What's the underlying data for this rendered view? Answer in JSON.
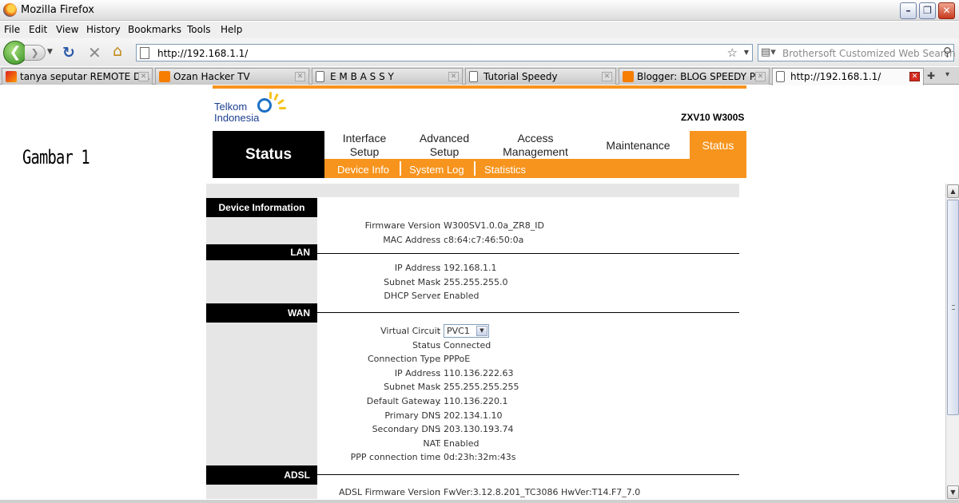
{
  "window": {
    "title": "Mozilla Firefox"
  },
  "menubar": [
    "File",
    "Edit",
    "View",
    "History",
    "Bookmarks",
    "Tools",
    "Help"
  ],
  "nav": {
    "url": "http://192.168.1.1/",
    "search_placeholder": "Brothersoft Customized Web Search"
  },
  "tabs": [
    {
      "label": "tanya seputar REMOTE D...",
      "icon": "red-site-icon"
    },
    {
      "label": "Ozan Hacker TV",
      "icon": "blogger-icon"
    },
    {
      "label": "E M B A S S Y",
      "icon": "page-icon"
    },
    {
      "label": "Tutorial Speedy",
      "icon": "page-icon"
    },
    {
      "label": "Blogger: BLOG SPEEDY P...",
      "icon": "blogger-icon"
    },
    {
      "label": "http://192.168.1.1/",
      "icon": "page-icon",
      "active": true
    }
  ],
  "page": {
    "caption": "Gambar 1",
    "logo_line1": "Telkom",
    "logo_line2": "Indonesia",
    "model": "ZXV10 W300S",
    "status_label": "Status",
    "menu": {
      "interface_l1": "Interface",
      "interface_l2": "Setup",
      "advanced_l1": "Advanced",
      "advanced_l2": "Setup",
      "access_l1": "Access",
      "access_l2": "Management",
      "maintenance": "Maintenance",
      "status": "Status"
    },
    "submenu": [
      "Device Info",
      "System Log",
      "Statistics"
    ],
    "sections": {
      "device_info": {
        "title": "Device Information",
        "rows": [
          {
            "label": "Firmware Version",
            "value": "W300SV1.0.0a_ZR8_ID"
          },
          {
            "label": "MAC Address",
            "value": "c8:64:c7:46:50:0a"
          }
        ]
      },
      "lan": {
        "title": "LAN",
        "rows": [
          {
            "label": "IP Address",
            "value": "192.168.1.1"
          },
          {
            "label": "Subnet Mask",
            "value": "255.255.255.0"
          },
          {
            "label": "DHCP Server",
            "value": "Enabled"
          }
        ]
      },
      "wan": {
        "title": "WAN",
        "virtual_circuit_label": "Virtual Circuit",
        "virtual_circuit_value": "PVC1",
        "rows": [
          {
            "label": "Status",
            "value": "Connected"
          },
          {
            "label": "Connection Type",
            "value": "PPPoE"
          },
          {
            "label": "IP Address",
            "value": "110.136.222.63"
          },
          {
            "label": "Subnet Mask",
            "value": "255.255.255.255"
          },
          {
            "label": "Default Gateway",
            "value": "110.136.220.1"
          },
          {
            "label": "Primary DNS",
            "value": "202.134.1.10"
          },
          {
            "label": "Secondary DNS",
            "value": "203.130.193.74"
          },
          {
            "label": "NAT",
            "value": "Enabled"
          },
          {
            "label": "PPP connection time",
            "value": "0d:23h:32m:43s"
          }
        ]
      },
      "adsl": {
        "title": "ADSL",
        "rows": [
          {
            "label": "ADSL Firmware Version",
            "value": "FwVer:3.12.8.201_TC3086 HwVer:T14.F7_7.0"
          }
        ]
      }
    }
  }
}
